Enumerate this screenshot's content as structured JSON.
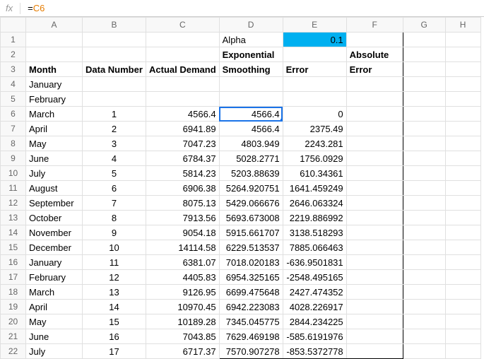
{
  "formula_bar": {
    "fx": "fx",
    "formula_eq": "=",
    "formula_ref": "C6"
  },
  "col_headers": [
    "A",
    "B",
    "C",
    "D",
    "E",
    "F",
    "G",
    "H"
  ],
  "row_headers": [
    "1",
    "2",
    "3",
    "4",
    "5",
    "6",
    "7",
    "8",
    "9",
    "10",
    "11",
    "12",
    "13",
    "14",
    "15",
    "16",
    "17",
    "18",
    "19",
    "20",
    "21",
    "22"
  ],
  "labels": {
    "alpha": "Alpha",
    "alpha_value": "0.1",
    "month": "Month",
    "data_number": "Data Number",
    "actual_demand": "Actual Demand",
    "exponential": "Exponential",
    "smoothing": "Smoothing",
    "error": "Error",
    "absolute": "Absolute",
    "error2": "Error"
  },
  "rows": [
    {
      "month": "January",
      "num": "",
      "actual": "",
      "smooth": "",
      "err": ""
    },
    {
      "month": "February",
      "num": "",
      "actual": "",
      "smooth": "",
      "err": ""
    },
    {
      "month": "March",
      "num": "1",
      "actual": "4566.4",
      "smooth": "4566.4",
      "err": "0"
    },
    {
      "month": "April",
      "num": "2",
      "actual": "6941.89",
      "smooth": "4566.4",
      "err": "2375.49"
    },
    {
      "month": "May",
      "num": "3",
      "actual": "7047.23",
      "smooth": "4803.949",
      "err": "2243.281"
    },
    {
      "month": "June",
      "num": "4",
      "actual": "6784.37",
      "smooth": "5028.2771",
      "err": "1756.0929"
    },
    {
      "month": "July",
      "num": "5",
      "actual": "5814.23",
      "smooth": "5203.88639",
      "err": "610.34361"
    },
    {
      "month": "August",
      "num": "6",
      "actual": "6906.38",
      "smooth": "5264.920751",
      "err": "1641.459249"
    },
    {
      "month": "September",
      "num": "7",
      "actual": "8075.13",
      "smooth": "5429.066676",
      "err": "2646.063324"
    },
    {
      "month": "October",
      "num": "8",
      "actual": "7913.56",
      "smooth": "5693.673008",
      "err": "2219.886992"
    },
    {
      "month": "November",
      "num": "9",
      "actual": "9054.18",
      "smooth": "5915.661707",
      "err": "3138.518293"
    },
    {
      "month": "December",
      "num": "10",
      "actual": "14114.58",
      "smooth": "6229.513537",
      "err": "7885.066463"
    },
    {
      "month": "January",
      "num": "11",
      "actual": "6381.07",
      "smooth": "7018.020183",
      "err": "-636.9501831"
    },
    {
      "month": "February",
      "num": "12",
      "actual": "4405.83",
      "smooth": "6954.325165",
      "err": "-2548.495165"
    },
    {
      "month": "March",
      "num": "13",
      "actual": "9126.95",
      "smooth": "6699.475648",
      "err": "2427.474352"
    },
    {
      "month": "April",
      "num": "14",
      "actual": "10970.45",
      "smooth": "6942.223083",
      "err": "4028.226917"
    },
    {
      "month": "May",
      "num": "15",
      "actual": "10189.28",
      "smooth": "7345.045775",
      "err": "2844.234225"
    },
    {
      "month": "June",
      "num": "16",
      "actual": "7043.85",
      "smooth": "7629.469198",
      "err": "-585.6191976"
    },
    {
      "month": "July",
      "num": "17",
      "actual": "6717.37",
      "smooth": "7570.907278",
      "err": "-853.5372778"
    }
  ]
}
